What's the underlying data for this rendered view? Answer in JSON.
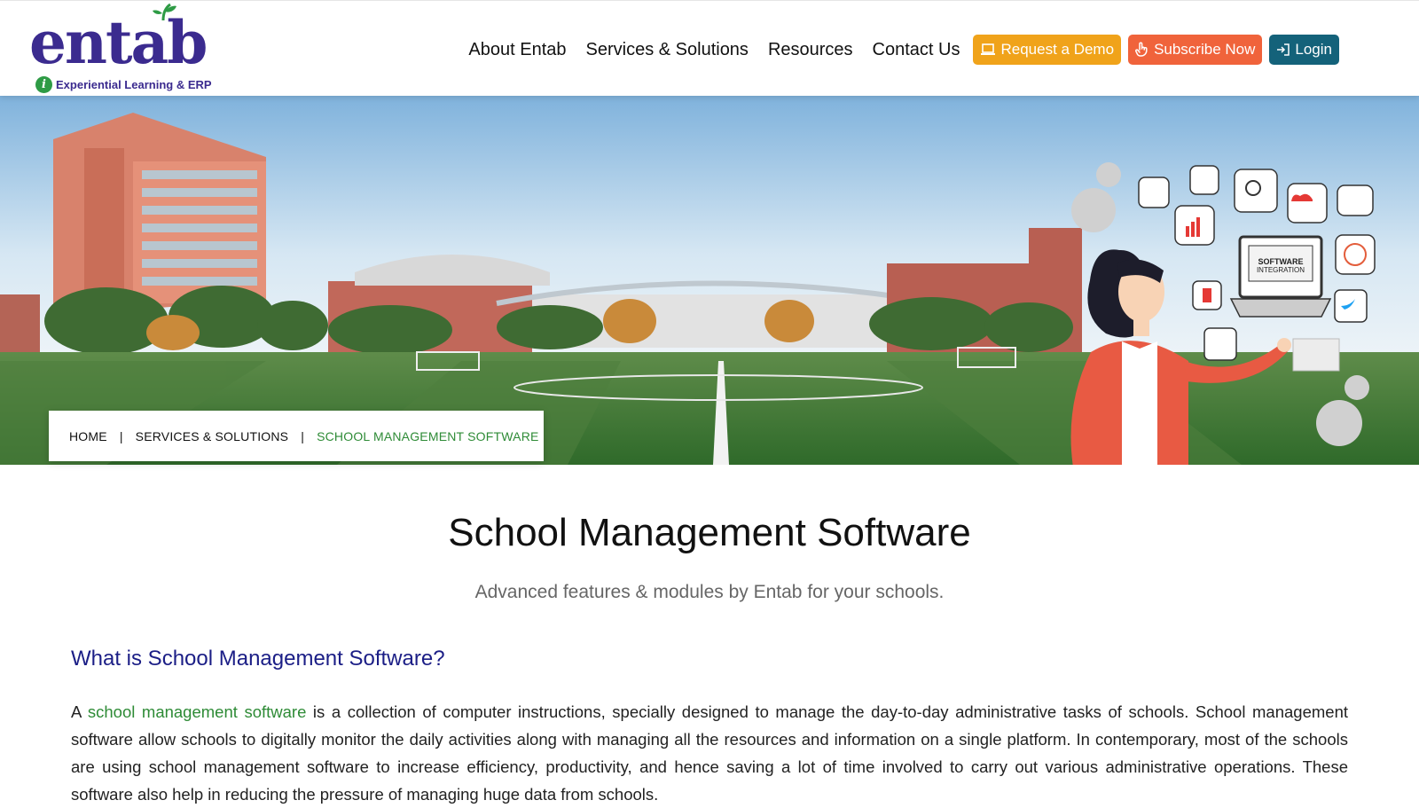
{
  "brand": {
    "logo_text": "entab",
    "tagline": "Experiential Learning & ERP",
    "badge_letter": "i",
    "primary_color": "#3b2b8f",
    "accent_color": "#2e9b45"
  },
  "nav": {
    "links": [
      "About Entab",
      "Services & Solutions",
      "Resources",
      "Contact Us"
    ],
    "request_demo": "Request a Demo",
    "subscribe": "Subscribe Now",
    "login": "Login",
    "colors": {
      "demo": "#f0a31a",
      "subscribe": "#f0633b",
      "login": "#14627a"
    }
  },
  "hero": {
    "illustration_label_1": "SOFTWARE",
    "illustration_label_2": "INTEGRATION"
  },
  "breadcrumb": {
    "home": "HOME",
    "section": "SERVICES & SOLUTIONS",
    "current": "SCHOOL MANAGEMENT SOFTWARE",
    "separator": "|"
  },
  "content": {
    "title": "School Management Software",
    "subtitle": "Advanced features & modules by Entab for your schools.",
    "section_heading": "What is School Management Software?",
    "para_prefix": "A ",
    "para_link": "school management software",
    "para_rest": " is a collection of computer instructions, specially designed to manage the day-to-day administrative tasks of schools. School management software allow schools to digitally monitor the daily activities along with managing all the resources and information on a single platform. In contemporary, most of the schools are using school management software to increase efficiency, productivity, and hence saving a lot of time involved to carry out various administrative operations. These software also help in reducing the pressure of managing huge data from schools."
  }
}
